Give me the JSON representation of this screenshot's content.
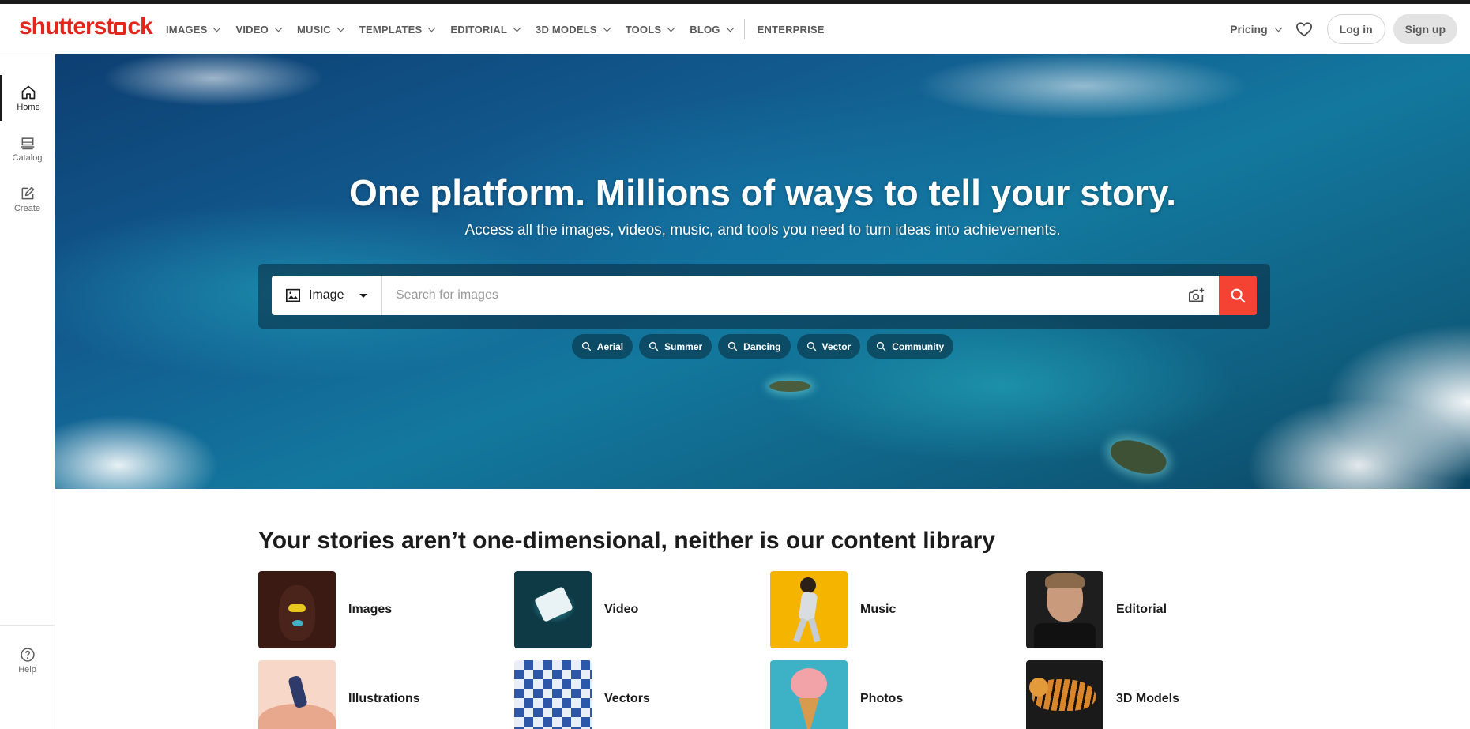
{
  "header": {
    "logo": "shutterstock",
    "nav": [
      {
        "label": "IMAGES"
      },
      {
        "label": "VIDEO"
      },
      {
        "label": "MUSIC"
      },
      {
        "label": "TEMPLATES"
      },
      {
        "label": "EDITORIAL"
      },
      {
        "label": "3D MODELS"
      },
      {
        "label": "TOOLS"
      },
      {
        "label": "BLOG"
      }
    ],
    "enterprise": "ENTERPRISE",
    "pricing": "Pricing",
    "login": "Log in",
    "signup": "Sign up"
  },
  "sidebar": {
    "items": [
      {
        "label": "Home",
        "icon": "home-icon"
      },
      {
        "label": "Catalog",
        "icon": "catalog-icon"
      },
      {
        "label": "Create",
        "icon": "create-icon"
      }
    ],
    "help": {
      "label": "Help",
      "icon": "help-icon"
    }
  },
  "hero": {
    "title": "One platform. Millions of ways to tell your story.",
    "subtitle": "Access all the images, videos, music, and tools you need to turn ideas into achievements.",
    "search": {
      "type": "Image",
      "placeholder": "Search for images"
    },
    "chips": [
      "Aerial",
      "Summer",
      "Dancing",
      "Vector",
      "Community"
    ]
  },
  "library": {
    "title": "Your stories aren’t one-dimensional, neither is our content library",
    "tiles": [
      {
        "label": "Images"
      },
      {
        "label": "Video"
      },
      {
        "label": "Music"
      },
      {
        "label": "Editorial"
      },
      {
        "label": "Illustrations"
      },
      {
        "label": "Vectors"
      },
      {
        "label": "Photos"
      },
      {
        "label": "3D Models"
      }
    ]
  },
  "colors": {
    "brand": "#e1261c",
    "search_button": "#f44332"
  }
}
